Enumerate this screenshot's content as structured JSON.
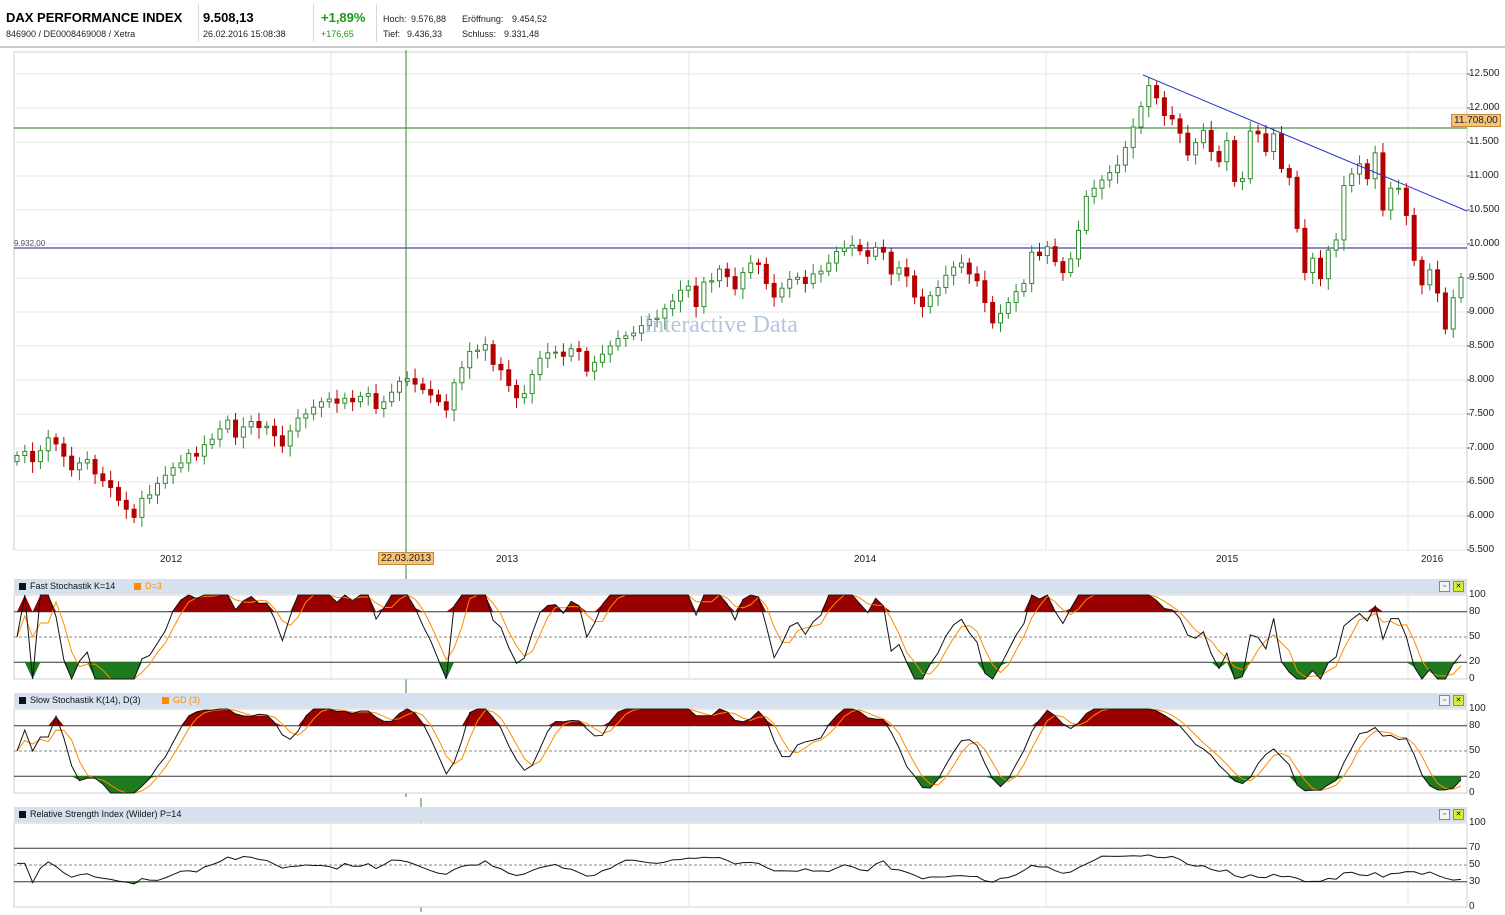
{
  "header": {
    "title": "DAX PERFORMANCE INDEX",
    "subtitle": "846900 / DE0008469008 / Xetra",
    "price": "9.508,13",
    "datetime": "26.02.2016 15:08:38",
    "change_pct": "+1,89%",
    "change_abs": "+176,65",
    "high_label": "Hoch:",
    "high_value": "9.576,88",
    "open_label": "Eröffnung:",
    "open_value": "9.454,52",
    "low_label": "Tief:",
    "low_value": "9.436,33",
    "close_label": "Schluss:",
    "close_value": "9.331,48"
  },
  "main_chart": {
    "watermark": "Interactive Data",
    "hline_label": "9.932,00",
    "price_marker": "11.708,00",
    "crosshair_date": "22.03.2013",
    "y_ticks": [
      "12.500",
      "12.000",
      "11.500",
      "11.000",
      "10.500",
      "10.000",
      "9.500",
      "9.000",
      "8.500",
      "8.000",
      "7.500",
      "7.000",
      "6.500",
      "6.000",
      "5.500"
    ],
    "x_ticks": [
      "2012",
      "2013",
      "2014",
      "2015",
      "2016"
    ]
  },
  "panels": [
    {
      "name": "fast-stochastic",
      "title": "Fast Stochastik K=14",
      "signal": "D=3",
      "ticks": [
        "100",
        "80",
        "50",
        "20",
        "0"
      ]
    },
    {
      "name": "slow-stochastic",
      "title": "Slow Stochastik K(14), D(3)",
      "signal": "GD (3)",
      "ticks": [
        "100",
        "80",
        "50",
        "20",
        "0"
      ]
    },
    {
      "name": "rsi",
      "title": "Relative Strength Index (Wilder) P=14",
      "signal": "",
      "ticks": [
        "100",
        "70",
        "50",
        "30",
        "0"
      ]
    }
  ],
  "colors": {
    "up": "#2e8b2e",
    "down": "#b40000",
    "grid": "#e4e4e4",
    "hline": "#1a1a8c",
    "trend": "#2233cc",
    "marker": "#f5c37a",
    "overbought": "#990000",
    "oversold": "#1e7a1e",
    "signal": "#ff8c00"
  },
  "chart_data": {
    "type": "candlestick",
    "series": [
      {
        "name": "DAX PERFORMANCE INDEX",
        "x_start": "2011-08",
        "interval": "week",
        "close": [
          6890,
          6950,
          6800,
          6960,
          7150,
          7060,
          6880,
          6680,
          6780,
          6830,
          6620,
          6520,
          6420,
          6230,
          6100,
          5980,
          6260,
          6310,
          6480,
          6600,
          6710,
          6780,
          6920,
          6880,
          7050,
          7130,
          7280,
          7410,
          7160,
          7310,
          7390,
          7300,
          7320,
          7180,
          7030,
          7250,
          7440,
          7500,
          7600,
          7680,
          7720,
          7660,
          7730,
          7680,
          7760,
          7800,
          7580,
          7680,
          7820,
          7980,
          8020,
          7940,
          7860,
          7780,
          7680,
          7560,
          7960,
          8180,
          8420,
          8440,
          8520,
          8230,
          8150,
          7920,
          7740,
          7800,
          8080,
          8320,
          8400,
          8410,
          8350,
          8460,
          8420,
          8130,
          8260,
          8380,
          8500,
          8610,
          8650,
          8690,
          8800,
          8890,
          8910,
          9050,
          9160,
          9320,
          9380,
          9080,
          9440,
          9460,
          9630,
          9520,
          9340,
          9580,
          9720,
          9700,
          9420,
          9220,
          9350,
          9480,
          9510,
          9420,
          9560,
          9600,
          9720,
          9890,
          9940,
          9980,
          9900,
          9820,
          9950,
          9880,
          9560,
          9650,
          9530,
          9220,
          9080,
          9240,
          9360,
          9540,
          9660,
          9720,
          9560,
          9460,
          9140,
          8840,
          8980,
          9140,
          9300,
          9420,
          9880,
          9830,
          9960,
          9740,
          9580,
          9780,
          10200,
          10700,
          10820,
          10940,
          11050,
          11160,
          11420,
          11720,
          12020,
          12330,
          12150,
          11890,
          11840,
          11630,
          11310,
          11490,
          11670,
          11360,
          11210,
          11520,
          10920,
          10960,
          11660,
          11620,
          11360,
          11620,
          11110,
          10980,
          10230,
          9580,
          9790,
          9490,
          9910,
          10060,
          10860,
          11030,
          11180,
          10960,
          11340,
          10500,
          10820,
          10820,
          10420,
          9760,
          9400,
          9620,
          9280,
          8750,
          9210,
          9508
        ]
      }
    ],
    "y_range": [
      5500,
      12500
    ],
    "x_ticks": [
      "2012",
      "2013",
      "2014",
      "2015",
      "2016"
    ]
  }
}
